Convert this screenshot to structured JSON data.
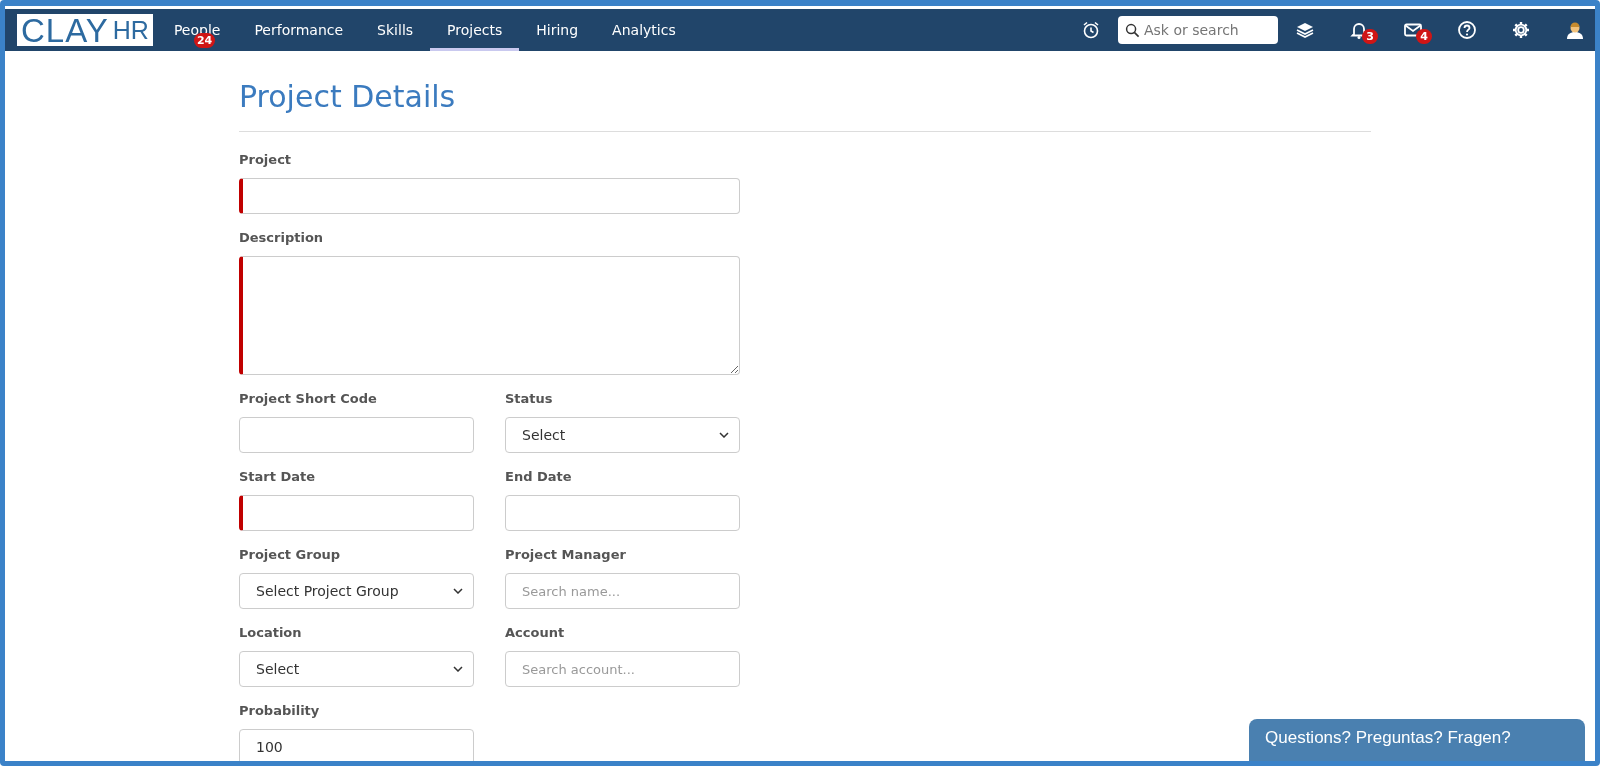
{
  "nav": {
    "logo": {
      "main": "CLAY",
      "sub": "HR"
    },
    "items": [
      {
        "label": "People",
        "badge": "24",
        "selected": false
      },
      {
        "label": "Performance",
        "selected": false
      },
      {
        "label": "Skills",
        "selected": false
      },
      {
        "label": "Projects",
        "selected": true
      },
      {
        "label": "Hiring",
        "selected": false
      },
      {
        "label": "Analytics",
        "selected": false
      }
    ],
    "search": {
      "placeholder": "Ask or search"
    },
    "notifications_badge": "3",
    "messages_badge": "4"
  },
  "page": {
    "title": "Project Details",
    "rows": [
      [
        {
          "label": "Project",
          "kind": "text",
          "required": true,
          "wide": true
        }
      ],
      [
        {
          "label": "Description",
          "kind": "textarea",
          "required": true,
          "wide": true
        }
      ],
      [
        {
          "label": "Project Short Code",
          "kind": "text",
          "required": false
        },
        {
          "label": "Status",
          "kind": "select",
          "value": "Select",
          "required": false
        }
      ],
      [
        {
          "label": "Start Date",
          "kind": "text",
          "required": true
        },
        {
          "label": "End Date",
          "kind": "text",
          "required": false
        }
      ],
      [
        {
          "label": "Project Group",
          "kind": "select",
          "value": "Select Project Group",
          "required": false
        },
        {
          "label": "Project Manager",
          "kind": "text",
          "placeholder": "Search name...",
          "required": false
        }
      ],
      [
        {
          "label": "Location",
          "kind": "select",
          "value": "Select",
          "required": false
        },
        {
          "label": "Account",
          "kind": "text",
          "placeholder": "Search account...",
          "required": false
        }
      ],
      [
        {
          "label": "Probability",
          "kind": "text",
          "value": "100",
          "required": false
        }
      ]
    ]
  },
  "chat": {
    "label": "Questions? Preguntas? Fragen?"
  }
}
